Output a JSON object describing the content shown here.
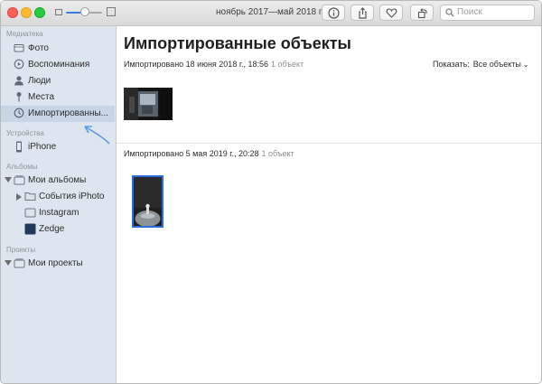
{
  "toolbar": {
    "date_range": "ноябрь 2017—май 2018 г.",
    "search_placeholder": "Поиск"
  },
  "sidebar": {
    "library_header": "Медиатека",
    "library_items": [
      {
        "label": "Фото",
        "icon": "photos-icon"
      },
      {
        "label": "Воспоминания",
        "icon": "memories-icon"
      },
      {
        "label": "Люди",
        "icon": "people-icon"
      },
      {
        "label": "Места",
        "icon": "places-icon"
      },
      {
        "label": "Импортированны...",
        "icon": "imports-clock-icon",
        "selected": true
      }
    ],
    "devices_header": "Устройства",
    "devices": [
      {
        "label": "iPhone",
        "icon": "iphone-icon"
      }
    ],
    "albums_header": "Альбомы",
    "my_albums": "Мои альбомы",
    "albums": [
      {
        "label": "События iPhoto",
        "icon": "folder-icon"
      },
      {
        "label": "Instagram",
        "icon": "album-icon"
      },
      {
        "label": "Zedge",
        "icon": "album-icon"
      }
    ],
    "projects_header": "Проекты",
    "my_projects": "Мои проекты"
  },
  "main": {
    "title": "Импортированные объекты",
    "show_label": "Показать:",
    "show_value": "Все объекты",
    "groups": [
      {
        "date": "Импортировано 18 июня 2018 г., 18:56",
        "count": "1 объект"
      },
      {
        "date": "Импортировано 5 мая 2019 г., 20:28",
        "count": "1 объект"
      }
    ]
  },
  "colors": {
    "accent": "#2a6ce0",
    "sidebar_bg": "#dde6ee",
    "selection_bg": "#c6d6e6",
    "annotation_arrow": "#5b9be8"
  }
}
